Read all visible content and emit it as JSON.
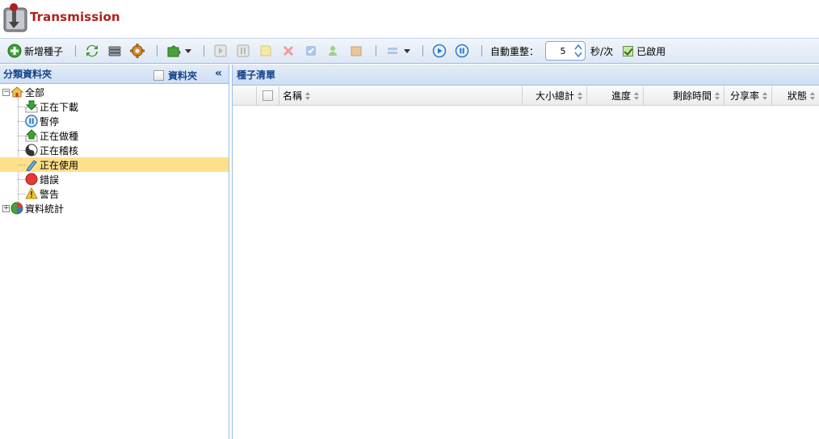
{
  "app": {
    "title": "Transmission"
  },
  "toolbar": {
    "add_torrent_label": "新增種子",
    "auto_refresh_label": "自動重整：",
    "refresh_value": "5",
    "unit_label": "秒/次",
    "enabled_label": "已啟用"
  },
  "left": {
    "title": "分類資料夾",
    "folder_label": "資料夾",
    "tree": [
      {
        "label": "全部",
        "icon": "home-icon"
      },
      {
        "label": "正在下載",
        "icon": "download-arrow-icon"
      },
      {
        "label": "暫停",
        "icon": "pause-icon"
      },
      {
        "label": "正在做種",
        "icon": "upload-arrow-icon"
      },
      {
        "label": "正在稽核",
        "icon": "check-yin-yang-icon"
      },
      {
        "label": "正在使用",
        "icon": "active-pen-icon"
      },
      {
        "label": "錯誤",
        "icon": "error-stop-icon"
      },
      {
        "label": "警告",
        "icon": "warning-icon"
      },
      {
        "label": "資料統計",
        "icon": "pie-chart-icon"
      }
    ]
  },
  "right": {
    "title": "種子清單",
    "columns": [
      "名稱",
      "大小總計",
      "進度",
      "剩餘時間",
      "分享率",
      "狀態"
    ]
  }
}
